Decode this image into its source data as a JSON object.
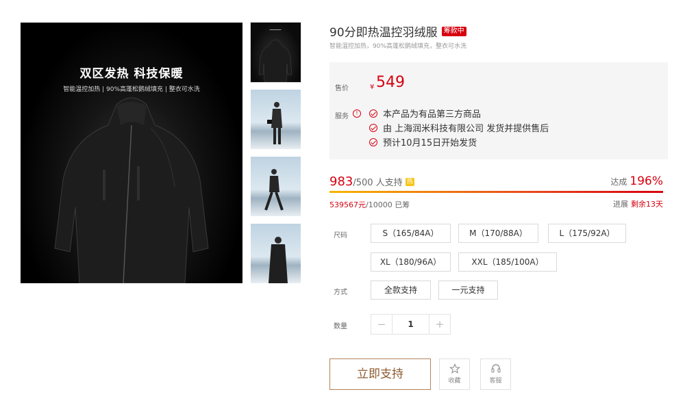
{
  "gallery": {
    "headline": "双区发热 科技保暖",
    "subline": "智能温控加热 | 90%高蓬松鹅绒填充 | 整衣可水洗"
  },
  "product": {
    "title": "90分即热温控羽绒服",
    "badge": "筹款中",
    "subtitle": "智能温控加热，90%高蓬松鹅绒填充，整衣可水洗"
  },
  "price": {
    "label": "售价",
    "currency": "¥",
    "value": "549"
  },
  "service": {
    "label": "服务",
    "info_icon": "ⓘ",
    "items": [
      "本产品为有品第三方商品",
      "由 上海润米科技有限公司 发货并提供售后",
      "预计10月15日开始发货"
    ]
  },
  "progress": {
    "supporters": "983",
    "supporters_suffix": "/500 人支持",
    "hot_badge": "热",
    "reach_label": "达成",
    "reach_percent": "196%",
    "fill_fraction": 1.0,
    "raised": "539567元",
    "raised_suffix": "/10000 已筹",
    "remain_label": "进展",
    "remain_days": "剩余13天"
  },
  "options": {
    "size_label": "尺码",
    "sizes": [
      "S（165/84A）",
      "M（170/88A）",
      "L（175/92A）",
      "XL（180/96A）",
      "XXL（185/100A）"
    ],
    "mode_label": "方式",
    "modes": [
      "全款支持",
      "一元支持"
    ],
    "qty_label": "数量",
    "qty_minus": "−",
    "qty_value": "1",
    "qty_plus": "+"
  },
  "actions": {
    "support": "立即支持",
    "favorite": "收藏",
    "service": "客服"
  },
  "colors": {
    "accent": "#d6000f",
    "support_border": "#b2825a"
  }
}
